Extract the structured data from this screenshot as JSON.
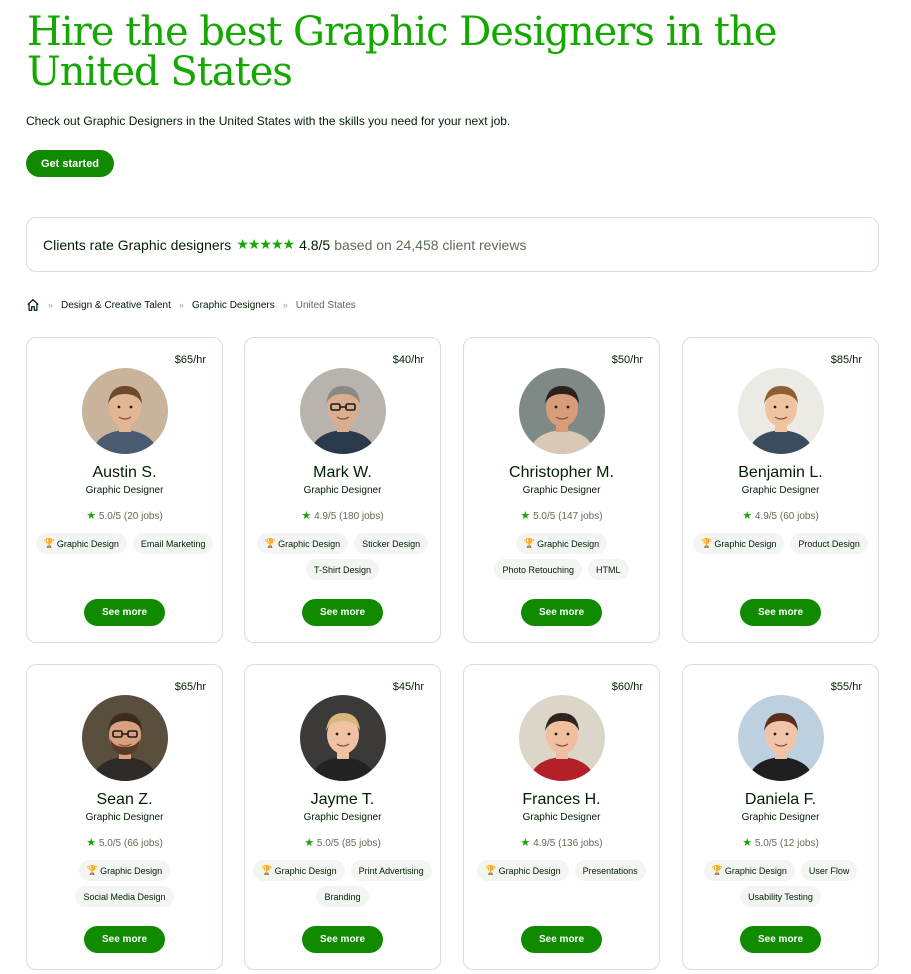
{
  "hero": {
    "title": "Hire the best Graphic Designers in the United States",
    "subtitle": "Check out Graphic Designers in the United States with the skills you need for your next job.",
    "cta_label": "Get started"
  },
  "rating": {
    "lead": "Clients rate Graphic designers",
    "stars": "★★★★★",
    "score": "4.8/5",
    "based_on": "based on 24,458 client reviews"
  },
  "breadcrumb": {
    "items": [
      "Design & Creative Talent",
      "Graphic Designers"
    ],
    "current": "United States",
    "separator": "»"
  },
  "colors": {
    "brand": "#14a800",
    "button": "#108a00",
    "chip_bg": "#f2f5f2",
    "border": "#d5e0d5"
  },
  "freelancers": [
    {
      "rate": "$65/hr",
      "name": "Austin S.",
      "title": "Graphic Designer",
      "score": "5.0/5",
      "jobs": "(20 jobs)",
      "skills": [
        "Graphic Design",
        "Email Marketing"
      ],
      "see_more": "See more"
    },
    {
      "rate": "$40/hr",
      "name": "Mark W.",
      "title": "Graphic Designer",
      "score": "4.9/5",
      "jobs": "(180 jobs)",
      "skills": [
        "Graphic Design",
        "Sticker Design",
        "T-Shirt Design"
      ],
      "see_more": "See more"
    },
    {
      "rate": "$50/hr",
      "name": "Christopher M.",
      "title": "Graphic Designer",
      "score": "5.0/5",
      "jobs": "(147 jobs)",
      "skills": [
        "Graphic Design",
        "Photo Retouching",
        "HTML"
      ],
      "see_more": "See more"
    },
    {
      "rate": "$85/hr",
      "name": "Benjamin L.",
      "title": "Graphic Designer",
      "score": "4.9/5",
      "jobs": "(60 jobs)",
      "skills": [
        "Graphic Design",
        "Product Design"
      ],
      "see_more": "See more"
    },
    {
      "rate": "$65/hr",
      "name": "Sean Z.",
      "title": "Graphic Designer",
      "score": "5.0/5",
      "jobs": "(66 jobs)",
      "skills": [
        "Graphic Design",
        "Social Media Design"
      ],
      "see_more": "See more"
    },
    {
      "rate": "$45/hr",
      "name": "Jayme T.",
      "title": "Graphic Designer",
      "score": "5.0/5",
      "jobs": "(85 jobs)",
      "skills": [
        "Graphic Design",
        "Print Advertising",
        "Branding"
      ],
      "see_more": "See more"
    },
    {
      "rate": "$60/hr",
      "name": "Frances H.",
      "title": "Graphic Designer",
      "score": "4.9/5",
      "jobs": "(136 jobs)",
      "skills": [
        "Graphic Design",
        "Presentations"
      ],
      "see_more": "See more"
    },
    {
      "rate": "$55/hr",
      "name": "Daniela F.",
      "title": "Graphic Designer",
      "score": "5.0/5",
      "jobs": "(12 jobs)",
      "skills": [
        "Graphic Design",
        "User Flow",
        "Usability Testing"
      ],
      "see_more": "See more"
    }
  ]
}
